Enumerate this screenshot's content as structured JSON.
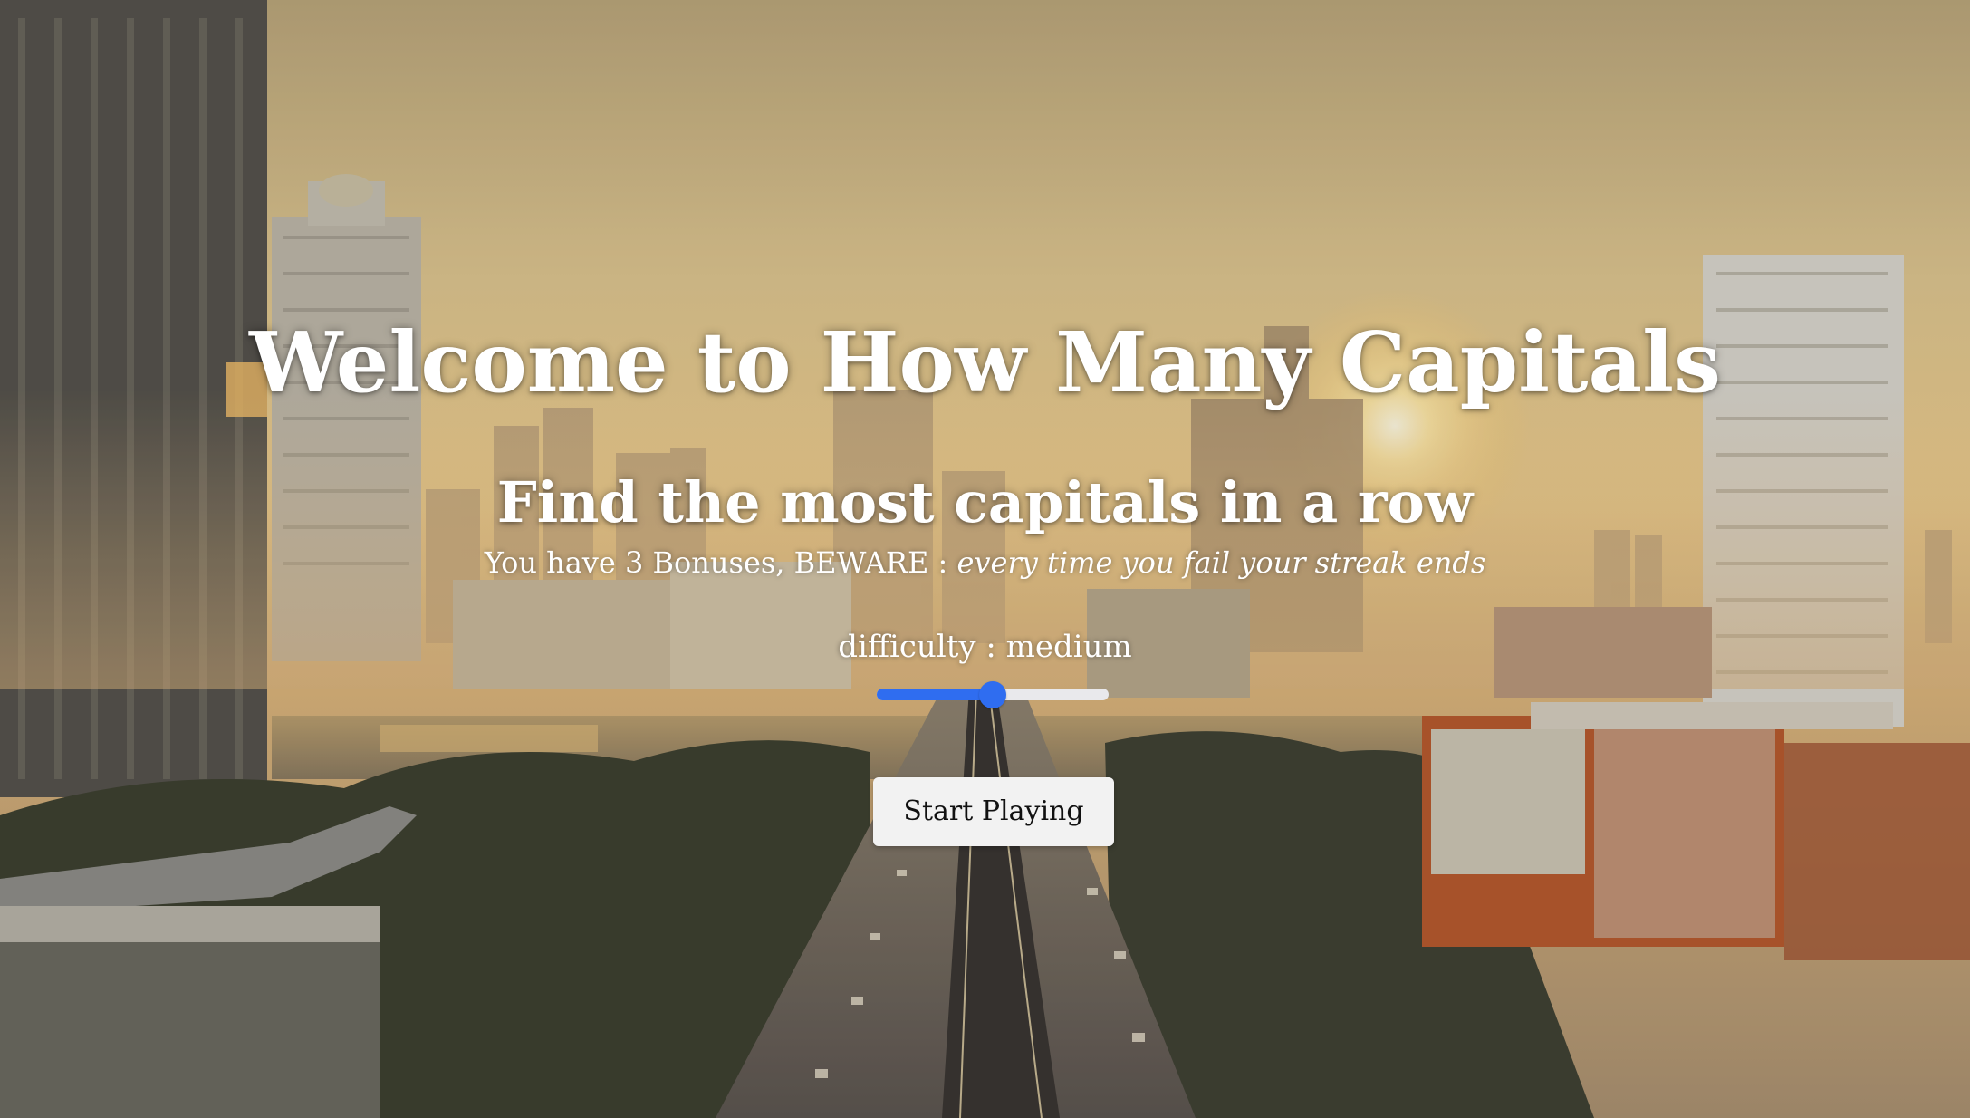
{
  "header": {
    "title": "Welcome to How Many Capitals",
    "subtitle": "Find the most capitals in a row"
  },
  "info": {
    "bonus_text": "You have 3 Bonuses, BEWARE :",
    "warning_text": "every time you fail your streak ends"
  },
  "difficulty": {
    "label": "difficulty : medium",
    "slider_level": 0.5
  },
  "actions": {
    "start_label": "Start Playing"
  },
  "colors": {
    "accent": "#2f6df0",
    "slider_track": "#e9e9ec",
    "button_bg": "#f2f2f2",
    "heading_text": "#ffffff"
  }
}
